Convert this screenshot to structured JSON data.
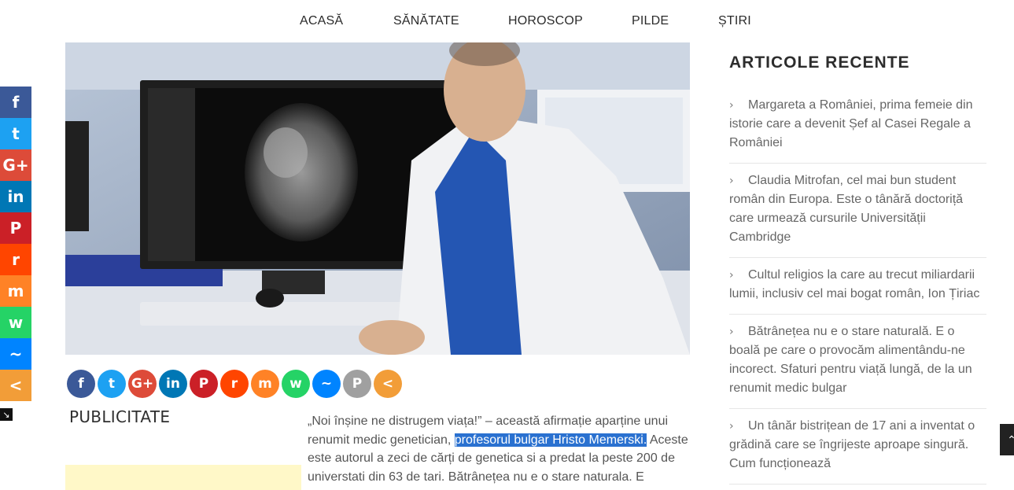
{
  "nav": {
    "items": [
      "ACASĂ",
      "SĂNĂTATE",
      "HOROSCOP",
      "PILDE",
      "ȘTIRI"
    ]
  },
  "side_share": {
    "buttons": [
      {
        "icon": "facebook-icon",
        "glyph": "f",
        "color": "#3b5998"
      },
      {
        "icon": "twitter-icon",
        "glyph": "t",
        "color": "#1da1f2"
      },
      {
        "icon": "google-plus-icon",
        "glyph": "G+",
        "color": "#dd4b39"
      },
      {
        "icon": "linkedin-icon",
        "glyph": "in",
        "color": "#0077b5"
      },
      {
        "icon": "pinterest-icon",
        "glyph": "P",
        "color": "#cb2027"
      },
      {
        "icon": "reddit-icon",
        "glyph": "r",
        "color": "#ff4500"
      },
      {
        "icon": "mix-icon",
        "glyph": "m",
        "color": "#ff8226"
      },
      {
        "icon": "whatsapp-icon",
        "glyph": "w",
        "color": "#25d366"
      },
      {
        "icon": "messenger-icon",
        "glyph": "~",
        "color": "#0084ff"
      },
      {
        "icon": "share-icon",
        "glyph": "<",
        "color": "#f29d38"
      }
    ]
  },
  "share_row": {
    "buttons": [
      {
        "icon": "facebook-icon",
        "glyph": "f",
        "color": "#3b5998"
      },
      {
        "icon": "twitter-icon",
        "glyph": "t",
        "color": "#1da1f2"
      },
      {
        "icon": "google-plus-icon",
        "glyph": "G+",
        "color": "#dd4b39"
      },
      {
        "icon": "linkedin-icon",
        "glyph": "in",
        "color": "#0077b5"
      },
      {
        "icon": "pinterest-icon",
        "glyph": "P",
        "color": "#cb2027"
      },
      {
        "icon": "reddit-icon",
        "glyph": "r",
        "color": "#ff4500"
      },
      {
        "icon": "mix-icon",
        "glyph": "m",
        "color": "#ff8226"
      },
      {
        "icon": "whatsapp-icon",
        "glyph": "w",
        "color": "#25d366"
      },
      {
        "icon": "messenger-icon",
        "glyph": "~",
        "color": "#0084ff"
      },
      {
        "icon": "print-icon",
        "glyph": "P",
        "color": "#a0a0a0"
      },
      {
        "icon": "share-icon",
        "glyph": "<",
        "color": "#f29d38"
      }
    ]
  },
  "publicitate": "PUBLICITATE",
  "article": {
    "part1": "„Noi înșine ne distrugem viața!” – această afirmație aparține unui renumit medic genetician, ",
    "highlight": "profesorul bulgar Hristo Memerski.",
    "part2": " Aceste este autorul a zeci de cărți de genetica si a predat la peste 200 de universtati din 63 de tari. Bătrânețea nu e o stare naturala. E"
  },
  "recent": {
    "title": "ARTICOLE RECENTE",
    "items": [
      "Margareta a României, prima femeie din istorie care a devenit Șef al Casei Regale a României",
      "Claudia Mitrofan, cel mai bun student român din Europa. Este o tânără doctoriță care urmează cursurile Universității Cambridge",
      "Cultul religios la care au trecut miliardarii lumii, inclusiv cel mai bogat român, Ion Țiriac",
      "Bătrânețea nu e o stare naturală. E o boală pe care o provocăm alimentându-ne incorect. Sfaturi pentru viață lungă, de la un renumit medic bulgar",
      "Un tânăr bistrițean de 17 ani a inventat o grădină care se îngrijeste aproape singură. Cum funcționează"
    ]
  }
}
